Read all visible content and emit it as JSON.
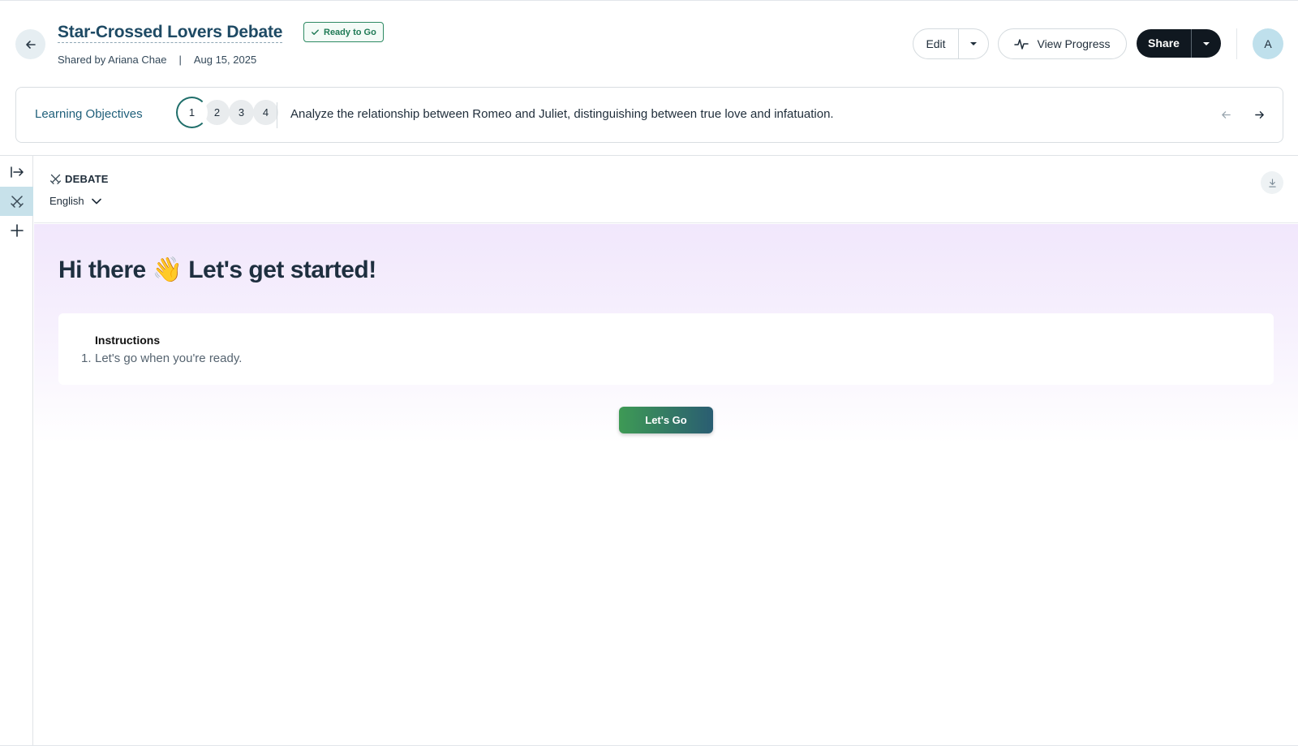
{
  "header": {
    "title": "Star-Crossed Lovers Debate",
    "status_badge": "Ready to Go",
    "shared_by": "Shared by Ariana Chae",
    "separator": "|",
    "date": "Aug 15, 2025",
    "edit_label": "Edit",
    "view_progress_label": "View Progress",
    "share_label": "Share",
    "avatar_initial": "A"
  },
  "objectives": {
    "label": "Learning Objectives",
    "steps": [
      "1",
      "2",
      "3",
      "4"
    ],
    "active_step": 1,
    "text": "Analyze the relationship between Romeo and Juliet, distinguishing between true love and infatuation."
  },
  "sidebar": {
    "items": [
      {
        "icon": "expand-panel-icon"
      },
      {
        "icon": "crossed-swords-icon",
        "active": true
      },
      {
        "icon": "plus-icon"
      }
    ]
  },
  "tool": {
    "title": "DEBATE",
    "language": "English"
  },
  "content": {
    "greeting": "Hi there 👋 Let's get started!",
    "instructions_title": "Instructions",
    "instructions": [
      "Let's go when you're ready."
    ],
    "go_label": "Let's Go"
  },
  "colors": {
    "accent": "#1f5f7a",
    "badge_green": "#2e8a63",
    "share_dark": "#101820",
    "content_gradient_top": "#f1e7fc",
    "go_gradient_start": "#3e9a55",
    "go_gradient_end": "#2a5d72"
  }
}
